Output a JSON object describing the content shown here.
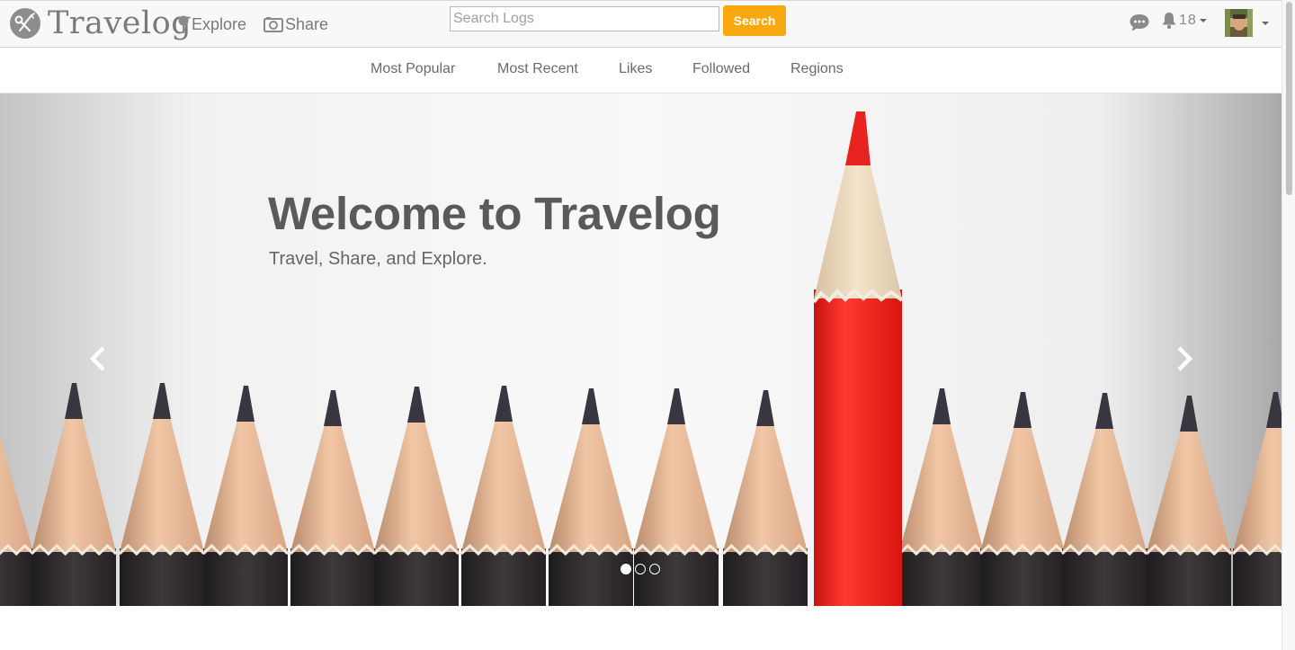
{
  "navbar": {
    "brand": "Travelog",
    "explore_label": "Explore",
    "share_label": "Share",
    "search": {
      "placeholder": "Search Logs",
      "value": "",
      "button_label": "Search"
    },
    "notifications_count": "18"
  },
  "subnav": {
    "items": [
      {
        "label": "Most Popular"
      },
      {
        "label": "Most Recent"
      },
      {
        "label": "Likes"
      },
      {
        "label": "Followed"
      },
      {
        "label": "Regions"
      }
    ]
  },
  "carousel": {
    "title": "Welcome to Travelog",
    "subtitle": "Travel, Share, and Explore.",
    "slide_count": 3,
    "active_slide": 1
  },
  "colors": {
    "accent": "#f9a80e",
    "pencil_red": "#e8231f",
    "text_gray": "#5a5a5a"
  }
}
